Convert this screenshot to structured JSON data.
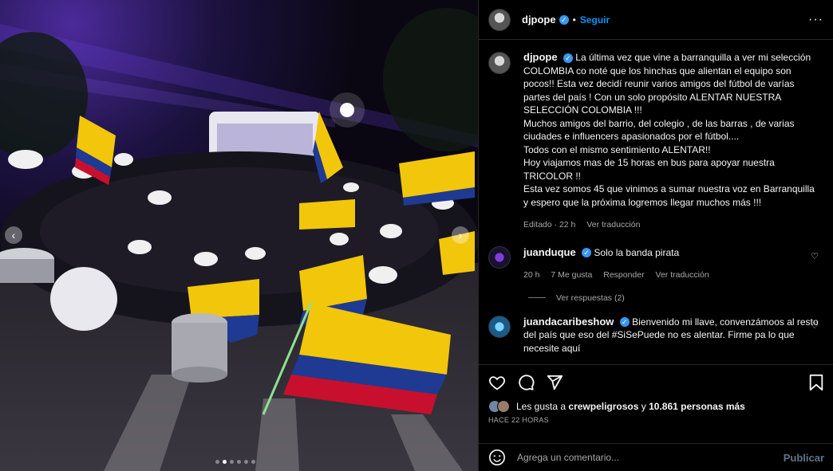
{
  "post": {
    "username": "djpope",
    "follow_label": "Seguir",
    "separator": "•",
    "more_label": "···"
  },
  "caption": {
    "username": "djpope",
    "text": "La última vez que vine a barranquilla a ver mi selección COLOMBIA co noté que los hinchas que alientan el equipo son pocos!! Esta vez decidí reunir varios amigos del fútbol de varías partes del país ! Con un solo propósito ALENTAR NUESTRA SELECCIÓN COLOMBIA !!!",
    "line2": "Muchos amigos del barrio, del colegio , de las barras , de varias ciudades e influencers apasionados por el fútbol....",
    "line3": "Todos con el mismo sentimiento ALENTAR!!",
    "line4": "Hoy viajamos mas de 15 horas en bus para apoyar nuestra TRICOLOR !!",
    "line5": "Esta vez somos 45 que vinimos a sumar nuestra voz en Barranquilla y espero que la próxima logremos llegar muchos más !!!",
    "edited": "Editado · 22 h",
    "translate": "Ver traducción"
  },
  "comments": [
    {
      "username": "juanduque",
      "text": "Solo la banda pirata",
      "time": "20 h",
      "likes": "7 Me gusta",
      "reply": "Responder",
      "translate": "Ver traducción",
      "view_replies": "Ver respuestas (2)"
    },
    {
      "username": "juandacaribeshow",
      "text": "Bienvenido mi llave, convenzámoos al resto del país que eso del #SiSePuede no es alentar. Firme pa lo que necesite aquí"
    }
  ],
  "likes": {
    "prefix": "Les gusta a ",
    "first": "crewpeligrosos",
    "middle": " y ",
    "rest": "10.861 personas más"
  },
  "timestamp": "HACE 22 HORAS",
  "comment_input": {
    "placeholder": "Agrega un comentario..."
  },
  "publish_label": "Publicar",
  "carousel": {
    "total": 6,
    "active": 2
  },
  "colors": {
    "accent": "#0095f6",
    "verified": "#3897f0",
    "flag_yellow": "#f2c60b",
    "flag_blue": "#1f3a93",
    "flag_red": "#c8102e"
  },
  "icons": [
    "chevron-left-icon",
    "chevron-right-icon",
    "heart-icon",
    "comment-icon",
    "share-icon",
    "bookmark-icon",
    "emoji-icon",
    "more-icon",
    "verified-icon"
  ]
}
